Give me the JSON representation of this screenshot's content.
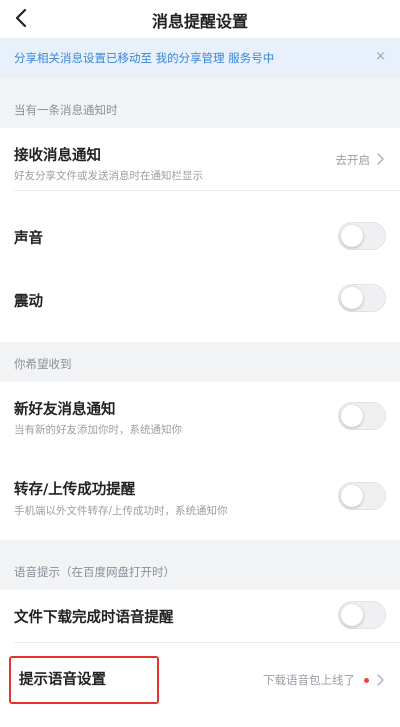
{
  "header": {
    "title": "消息提醒设置"
  },
  "banner": {
    "text": "分享相关消息设置已移动至 我的分享管理 服务号中",
    "close": "×"
  },
  "sections": {
    "section1": {
      "label": "当有一条消息通知时"
    },
    "section2": {
      "label": "你希望收到"
    },
    "section3": {
      "label": "语音提示（在百度网盘打开时）"
    }
  },
  "rows": {
    "receive": {
      "title": "接收消息通知",
      "subtitle": "好友分享文件或发送消息时在通知栏显示",
      "value": "去开启"
    },
    "sound": {
      "title": "声音",
      "toggle": false
    },
    "vibrate": {
      "title": "震动",
      "toggle": false
    },
    "new_friend": {
      "title": "新好友消息通知",
      "subtitle": "当有新的好友添加你时，系统通知你",
      "toggle": false
    },
    "transfer": {
      "title": "转存/上传成功提醒",
      "subtitle": "手机端以外文件转存/上传成功时，系统通知你",
      "toggle": false
    },
    "download_voice": {
      "title": "文件下载完成时语音提醒",
      "toggle": false
    },
    "voice_settings": {
      "title": "提示语音设置",
      "value": "下载语音包上线了"
    }
  },
  "colors": {
    "accent": "#3a86d8",
    "highlight": "#e5332e",
    "badge": "#f0443a"
  }
}
